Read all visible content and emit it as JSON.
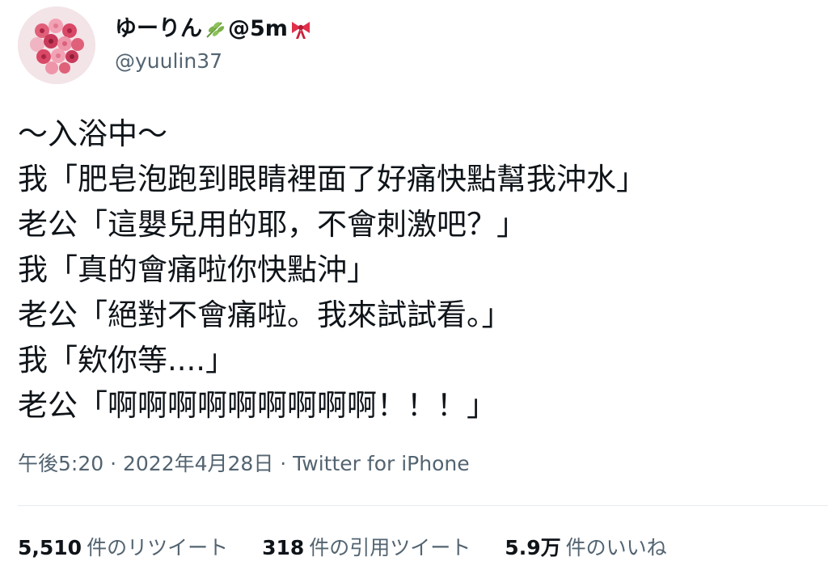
{
  "author": {
    "display_name_part1": "ゆーりん",
    "display_name_part2": "@5m",
    "name_emoji_1": "herb-icon",
    "name_emoji_2": "ribbon-icon",
    "handle": "@yuulin37"
  },
  "tweet": {
    "lines": [
      "～入浴中～",
      "我「肥皂泡跑到眼睛裡面了好痛快點幫我沖水」",
      "老公「這嬰兒用的耶，不會刺激吧？」",
      "我「真的會痛啦你快點沖」",
      "老公「絕對不會痛啦。我來試試看。」",
      "我「欸你等....」",
      "老公「啊啊啊啊啊啊啊啊啊！！！」"
    ],
    "timestamp": "午後5:20 · 2022年4月28日 · Twitter for iPhone"
  },
  "stats": {
    "retweets_count": "5,510",
    "retweets_label": "件のリツイート",
    "quotes_count": "318",
    "quotes_label": "件の引用ツイート",
    "likes_count": "5.9万",
    "likes_label": "件のいいね"
  },
  "colors": {
    "text": "#0f1419",
    "secondary": "#536471",
    "divider": "#e6ecf0"
  }
}
